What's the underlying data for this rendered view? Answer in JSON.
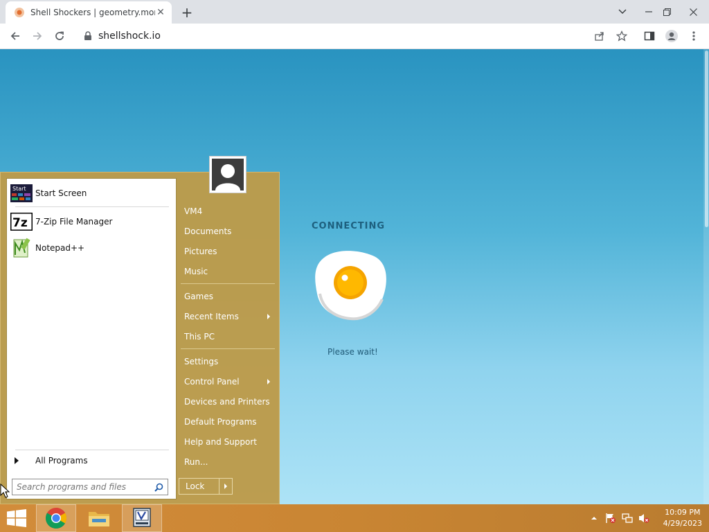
{
  "browser": {
    "tab_title": "Shell Shockers | geometry.monst",
    "url": "shellshock.io"
  },
  "page": {
    "status_heading": "CONNECTING",
    "wait_text": "Please wait!"
  },
  "start_menu": {
    "pinned": [
      {
        "label": "Start Screen",
        "icon": "start-screen-icon"
      },
      {
        "label": "7-Zip File Manager",
        "icon": "7zip-icon"
      },
      {
        "label": "Notepad++",
        "icon": "notepad-plus-plus-icon"
      }
    ],
    "all_programs": "All Programs",
    "search_placeholder": "Search programs and files",
    "right_items": {
      "vm4": "VM4",
      "documents": "Documents",
      "pictures": "Pictures",
      "music": "Music",
      "games": "Games",
      "recent_items": "Recent Items",
      "this_pc": "This PC",
      "settings": "Settings",
      "control_panel": "Control Panel",
      "devices_printers": "Devices and Printers",
      "default_programs": "Default Programs",
      "help_support": "Help and Support",
      "run": "Run..."
    },
    "lock_label": "Lock"
  },
  "taskbar": {
    "time": "10:09 PM",
    "date": "4/29/2023",
    "colors": {
      "accent": "#c98533"
    }
  }
}
